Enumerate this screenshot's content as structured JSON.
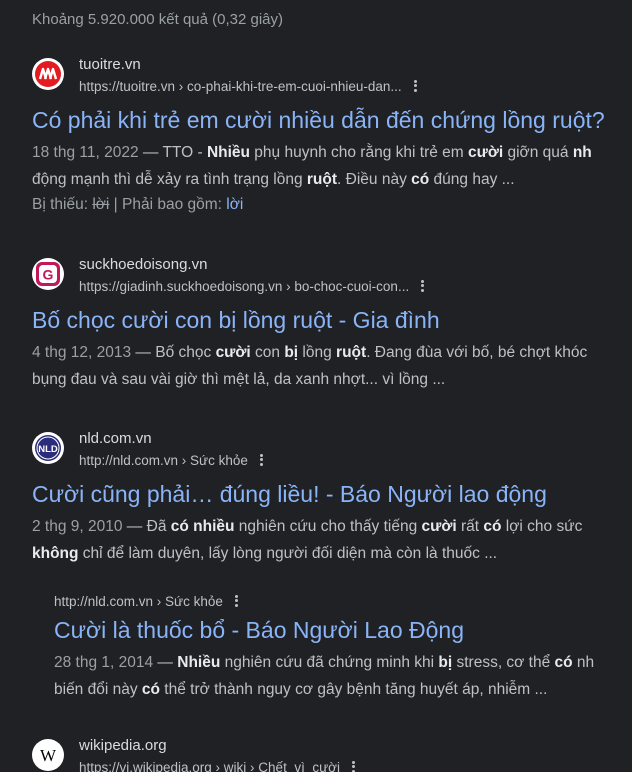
{
  "stats": "Khoảng 5.920.000 kết quả (0,32 giây)",
  "results": [
    {
      "site": "tuoitre.vn",
      "cite": "https://tuoitre.vn › co-phai-khi-tre-em-cuoi-nhieu-dan...",
      "title": "Có phải khi trẻ em cười nhiều dẫn đến chứng lồng ruột?",
      "date": "18 thg 11, 2022",
      "dash": " — ",
      "line1": [
        "TTO - ",
        "Nhiều",
        " phụ huynh cho rằng khi trẻ em ",
        "cười",
        " giỡn quá ",
        "nh"
      ],
      "line2": [
        "động mạnh thì dễ xảy ra tình trạng lồng ",
        "ruột",
        ". Điều này ",
        "có",
        " đúng hay ..."
      ],
      "missing_label": "Bị thiếu: ",
      "missing_word": "lời",
      "missing_sep": " | Phải bao gồm: ",
      "missing_link": "lời"
    },
    {
      "site": "suckhoedoisong.vn",
      "cite": "https://giadinh.suckhoedoisong.vn › bo-choc-cuoi-con...",
      "title": "Bố chọc cười con bị lồng ruột - Gia đình",
      "date": "4 thg 12, 2013",
      "dash": " — ",
      "line1": [
        "Bố chọc ",
        "cười",
        " con ",
        "bị",
        " lồng ",
        "ruột",
        ". Đang đùa với bố, bé chợt khóc"
      ],
      "line2": [
        "bụng đau và sau vài giờ thì mệt lả, da xanh nhợt... vì lồng ..."
      ]
    },
    {
      "site": "nld.com.vn",
      "cite": "http://nld.com.vn › Sức khỏe",
      "title": "Cười cũng phải… đúng liều! - Báo Người lao động",
      "date": "2 thg 9, 2010",
      "dash": " — ",
      "line1": [
        "Đã ",
        "có nhiều",
        " nghiên cứu cho thấy tiếng ",
        "cười",
        " rất ",
        "có",
        " lợi cho sức"
      ],
      "line2": [
        "không",
        " chỉ để làm duyên, lấy lòng người đối diện mà còn là thuốc ..."
      ]
    },
    {
      "cite": "http://nld.com.vn › Sức khỏe",
      "title": "Cười là thuốc bổ - Báo Người Lao Động",
      "date": "28 thg 1, 2014",
      "dash": " — ",
      "line1": [
        "Nhiều",
        " nghiên cứu đã chứng minh khi ",
        "bị",
        " stress, cơ thể ",
        "có",
        " nh"
      ],
      "line2": [
        "biến đổi này ",
        "có",
        " thể trở thành nguy cơ gây bệnh tăng huyết áp, nhiễm ..."
      ]
    },
    {
      "site": "wikipedia.org",
      "cite": "https://vi.wikipedia.org › wiki › Chết_vì_cười"
    }
  ],
  "favicons": {
    "tuoitre": {
      "bg": "#e31b23",
      "fg": "#ffffff",
      "icon": "tuoitre-logo-icon"
    },
    "suckhoe": {
      "bg": "#ffffff",
      "ring": "#c2185b",
      "letter": "G",
      "icon": "suckhoe-logo-icon"
    },
    "nld": {
      "bg": "#ffffff",
      "inner": "#2b2d7c",
      "text": "NLD",
      "icon": "nld-logo-icon"
    },
    "wiki": {
      "bg": "#ffffff",
      "letter": "W",
      "icon": "wikipedia-logo-icon"
    }
  },
  "colors": {
    "background": "#202124",
    "link": "#8ab4f8",
    "text": "#bdc1c6",
    "muted": "#9aa0a6"
  }
}
